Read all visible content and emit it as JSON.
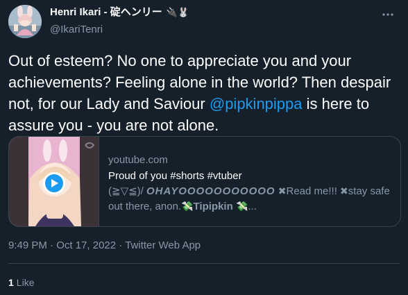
{
  "author": {
    "display_name": "Henri Ikari - 碇ヘンリー",
    "name_emoji": "🔌🐰",
    "handle": "@IkariTenri"
  },
  "tweet": {
    "text_before": "Out of esteem? No one to appreciate you and your achievements? Feeling alone in the world? Then despair not, for our Lady and Saviour ",
    "mention": "@pipkinpippa",
    "text_after": " is here to assure you - you are not alone."
  },
  "card": {
    "domain": "youtube.com",
    "title": "Proud of you #shorts #vtuber",
    "desc_face": "(≧▽≦)/",
    "desc_ohay": "OHAYOOOOOOOOOOO",
    "desc_cross1": "✖",
    "desc_readme": "Read me!!!",
    "desc_cross2": "✖",
    "desc_rest": "stay safe out there, anon.",
    "desc_money1": "💸",
    "desc_tipipkin": "Tipipkin",
    "desc_money2": "💸",
    "desc_ellipsis": "..."
  },
  "meta": {
    "time": "9:49 PM",
    "sep1": " · ",
    "date": "Oct 17, 2022",
    "sep2": " · ",
    "source": "Twitter Web App"
  },
  "stats": {
    "like_count": "1",
    "like_label": "Like"
  },
  "icons": {
    "more": "more-horizontal-icon",
    "play": "play-icon"
  }
}
